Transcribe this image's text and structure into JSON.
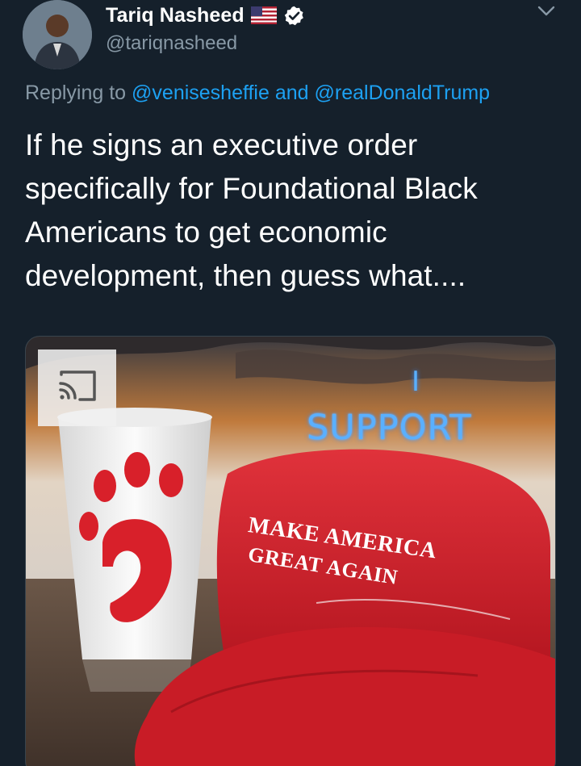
{
  "author": {
    "display_name": "Tariq Nasheed",
    "handle": "@tariqnasheed",
    "badges": [
      "us-flag-icon",
      "verified-icon"
    ]
  },
  "reply": {
    "prefix": "Replying to ",
    "mention_1": "@venisesheffie",
    "conjunction": " and ",
    "mention_2": "@realDonaldTrump"
  },
  "tweet": {
    "text": "If he signs an executive order\nspecifically for Foundational Black\nAmericans to get economic\ndevelopment, then guess what...."
  },
  "media": {
    "overlay_icon": "cast-icon",
    "sign_i": "I",
    "sign_support": "SUPPORT",
    "cap_line_1": "MAKE AMERICA",
    "cap_line_2": "GREAT AGAIN"
  },
  "colors": {
    "background": "#15202b",
    "secondary_text": "#8899a6",
    "link": "#1da1f2",
    "verified": "#ffffff",
    "cap_red": "#d8202a"
  }
}
